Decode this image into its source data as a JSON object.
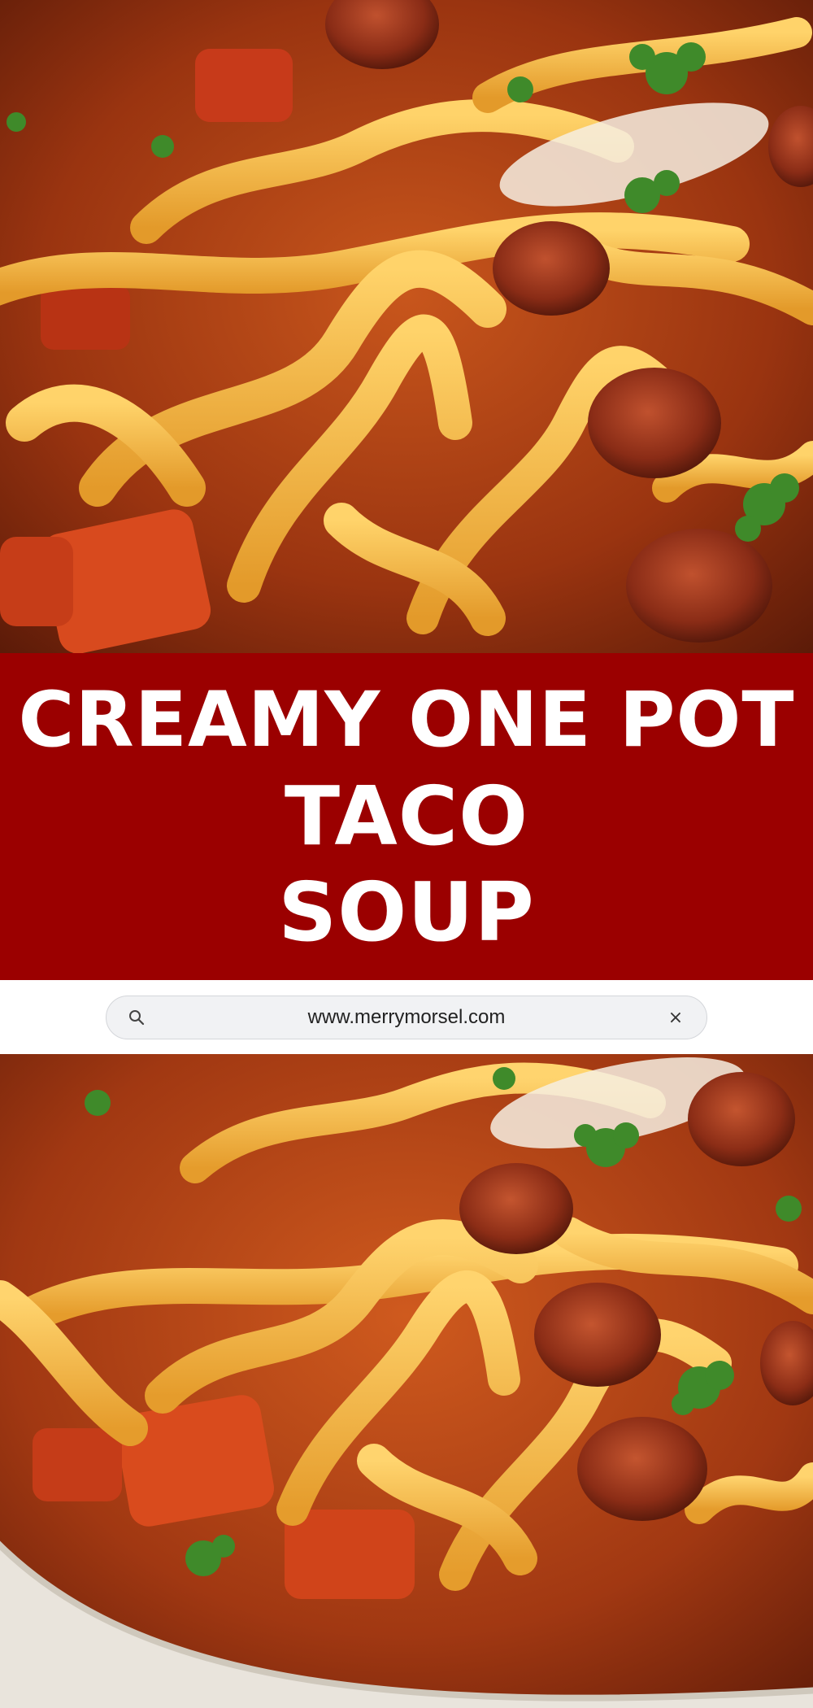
{
  "title": {
    "lines": [
      "CREAMY ONE POT",
      "TACO",
      "SOUP"
    ]
  },
  "url_bar": {
    "url": "www.merrymorsel.com",
    "search_icon": "search-icon",
    "close_icon": "close-icon",
    "close_glyph": "×"
  },
  "colors": {
    "title_band": "#9b0000",
    "title_text": "#ffffff",
    "url_bar_bg": "#f1f2f4"
  },
  "photos": {
    "top_alt": "close-up of taco soup with noodles, sausage slices, cheese and cilantro",
    "bottom_alt": "bowl of taco soup with noodles, sausage slices and cilantro"
  }
}
